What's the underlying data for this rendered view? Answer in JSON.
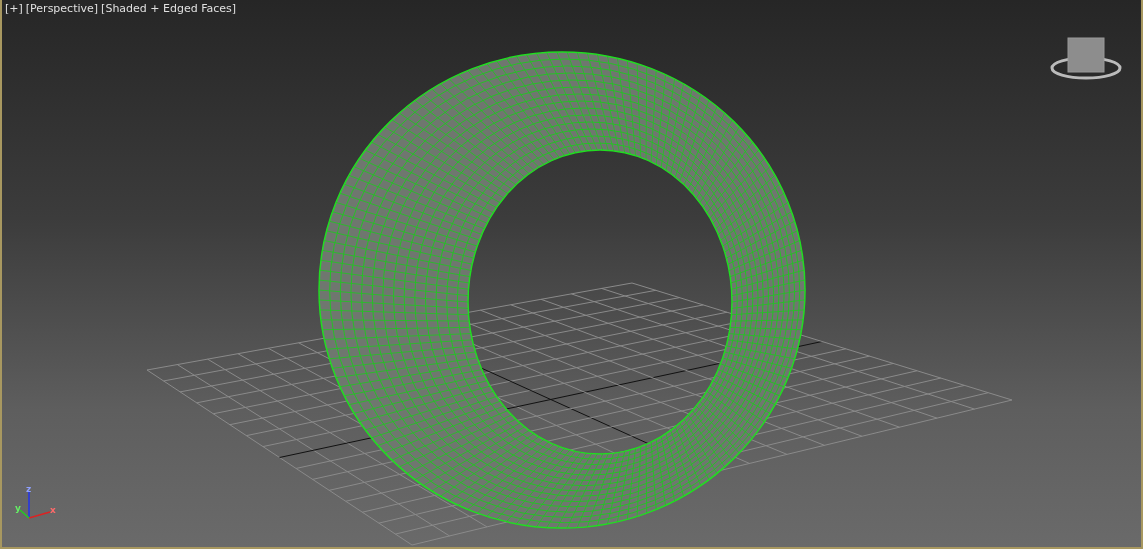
{
  "viewport": {
    "labels": [
      "[+]",
      "[Perspective]",
      "[Shaded + Edged Faces]"
    ],
    "axis_labels": [
      "z",
      "y",
      "x"
    ]
  }
}
